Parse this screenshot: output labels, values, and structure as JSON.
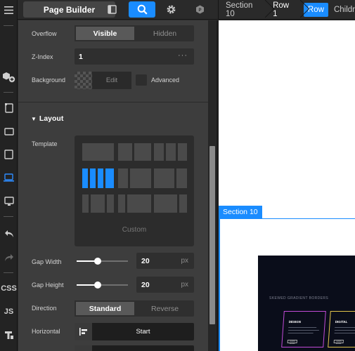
{
  "toolbar": {
    "page_builder_label": "Page Builder",
    "breadcrumbs": {
      "section": "Section 10",
      "row": "Row 1",
      "row_chip": "Row",
      "child": "Childr"
    }
  },
  "rail": {
    "css_label": "CSS",
    "js_label": "JS"
  },
  "panel": {
    "overflow": {
      "label": "Overflow",
      "options": [
        "Visible",
        "Hidden"
      ],
      "selected": "Visible"
    },
    "z_index": {
      "label": "Z-Index",
      "value": "1",
      "more": "···"
    },
    "background": {
      "label": "Background",
      "edit_label": "Edit",
      "advanced_label": "Advanced",
      "advanced_checked": false
    },
    "layout": {
      "title": "Layout",
      "template": {
        "label": "Template",
        "custom_label": "Custom",
        "selected_index": 4
      },
      "gap_width": {
        "label": "Gap Width",
        "value": "20",
        "unit": "px",
        "slider_fraction": 0.4
      },
      "gap_height": {
        "label": "Gap Height",
        "value": "20",
        "unit": "px",
        "slider_fraction": 0.4
      },
      "direction": {
        "label": "Direction",
        "options": [
          "Standard",
          "Reverse"
        ],
        "selected": "Standard"
      },
      "horizontal": {
        "label": "Horizontal",
        "value": "Start"
      }
    }
  },
  "canvas": {
    "section_chip": "Section 10",
    "preview": {
      "heading": "SKEWED GRADIENT BORDERS",
      "card_1_title": "DESIGN",
      "card_2_title": "DIGITAL",
      "button_label": "LEARN MORE"
    }
  },
  "colors": {
    "accent": "#1a8cff",
    "panel": "#3d3d3d",
    "rail": "#232323"
  }
}
